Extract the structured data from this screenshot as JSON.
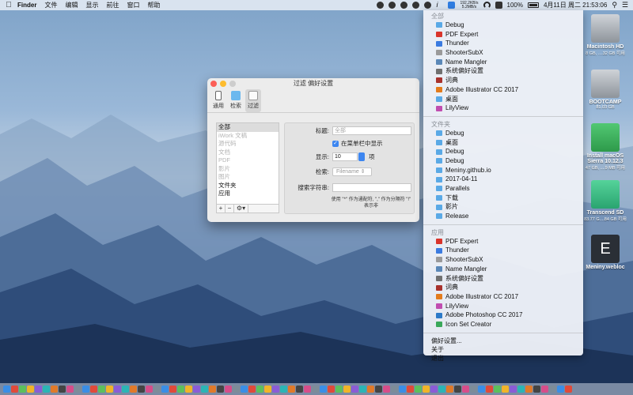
{
  "menubar": {
    "app_name": "Finder",
    "menus": [
      "文件",
      "编辑",
      "显示",
      "前往",
      "窗口",
      "帮助"
    ],
    "net_up": "192.2KB/s",
    "net_down": "5.2MB/s",
    "battery": "100%",
    "datetime": "4月11日 周二  21:53:06"
  },
  "dropdown": {
    "section_all": "全部",
    "all_items": [
      {
        "label": "Debug",
        "color": "#5aa9e6"
      },
      {
        "label": "PDF Expert",
        "color": "#d9342b"
      },
      {
        "label": "Thunder",
        "color": "#3b7be0"
      },
      {
        "label": "ShooterSubX",
        "color": "#9a9a9a"
      },
      {
        "label": "Name Mangler",
        "color": "#5b88b8"
      },
      {
        "label": "系统偏好设置",
        "color": "#707070"
      },
      {
        "label": "词典",
        "color": "#a8322d"
      },
      {
        "label": "Adobe Illustrator CC 2017",
        "color": "#e37b1c"
      },
      {
        "label": "桌面",
        "color": "#5aa9e6"
      },
      {
        "label": "LilyView",
        "color": "#c04db0"
      }
    ],
    "section_folders": "文件夹",
    "folder_items": [
      {
        "label": "Debug",
        "color": "#5aa9e6"
      },
      {
        "label": "桌面",
        "color": "#5aa9e6"
      },
      {
        "label": "Debug",
        "color": "#5aa9e6"
      },
      {
        "label": "Debug",
        "color": "#5aa9e6"
      },
      {
        "label": "Meniny.github.io",
        "color": "#5aa9e6"
      },
      {
        "label": "2017-04-11",
        "color": "#5aa9e6"
      },
      {
        "label": "Parallels",
        "color": "#5aa9e6"
      },
      {
        "label": "下载",
        "color": "#5aa9e6"
      },
      {
        "label": "影片",
        "color": "#5aa9e6"
      },
      {
        "label": "Release",
        "color": "#5aa9e6"
      }
    ],
    "section_apps": "应用",
    "app_items": [
      {
        "label": "PDF Expert",
        "color": "#d9342b"
      },
      {
        "label": "Thunder",
        "color": "#3b7be0"
      },
      {
        "label": "ShooterSubX",
        "color": "#9a9a9a"
      },
      {
        "label": "Name Mangler",
        "color": "#5b88b8"
      },
      {
        "label": "系统偏好设置",
        "color": "#707070"
      },
      {
        "label": "词典",
        "color": "#a8322d"
      },
      {
        "label": "Adobe Illustrator CC 2017",
        "color": "#e37b1c"
      },
      {
        "label": "LilyView",
        "color": "#c04db0"
      },
      {
        "label": "Adobe Photoshop CC 2017",
        "color": "#2d7ac8"
      },
      {
        "label": "Icon Set Creator",
        "color": "#3aa85a"
      }
    ],
    "preferences": "偏好设置...",
    "about": "关于",
    "quit": "退出"
  },
  "window": {
    "title": "过滤 偏好设置",
    "tabs": [
      "通用",
      "检索",
      "过滤"
    ],
    "selected_tab": "过滤",
    "filter_list": [
      {
        "label": "全部",
        "state": "selected"
      },
      {
        "label": "iWork 文稿",
        "state": "off"
      },
      {
        "label": "源代码",
        "state": "off"
      },
      {
        "label": "文档",
        "state": "off"
      },
      {
        "label": "PDF",
        "state": "off"
      },
      {
        "label": "影片",
        "state": "off"
      },
      {
        "label": "图片",
        "state": "off"
      },
      {
        "label": "文件夹",
        "state": "on"
      },
      {
        "label": "应用",
        "state": "on"
      }
    ],
    "list_buttons": {
      "add": "+",
      "remove": "−",
      "action": "⚙▾"
    },
    "title_label": "标题:",
    "title_placeholder": "全部",
    "show_in_menu_label": "在菜单栏中显示",
    "show_label": "显示:",
    "show_value": "10",
    "show_unit": "项",
    "search_label": "检索:",
    "search_select": "Filename",
    "search_string_label": "搜索字符串:",
    "hint_text": "使用 \"*\" 作为通配符, \",\" 作为分隔符 \"!\" 表示非"
  },
  "desktop": [
    {
      "title": "Macintosh HD",
      "sub": "8 GB, ....32 GB 可用",
      "color": "#9aa0a8"
    },
    {
      "title": "BOOTCAMP",
      "sub": "81.03 GB",
      "color": "#9aa0a8"
    },
    {
      "title": "Install macOS Sierra 10.12.3",
      "sub": "47 GB, ....9 MB 可用",
      "color": "#3bb05a"
    },
    {
      "title": "Transcend SD",
      "sub": "83.77 G....84 GB 可用",
      "color": "#3dbb80"
    },
    {
      "title": "Meniny.webloc",
      "sub": "",
      "color": "#2a2f36"
    }
  ],
  "dock_count": 72
}
